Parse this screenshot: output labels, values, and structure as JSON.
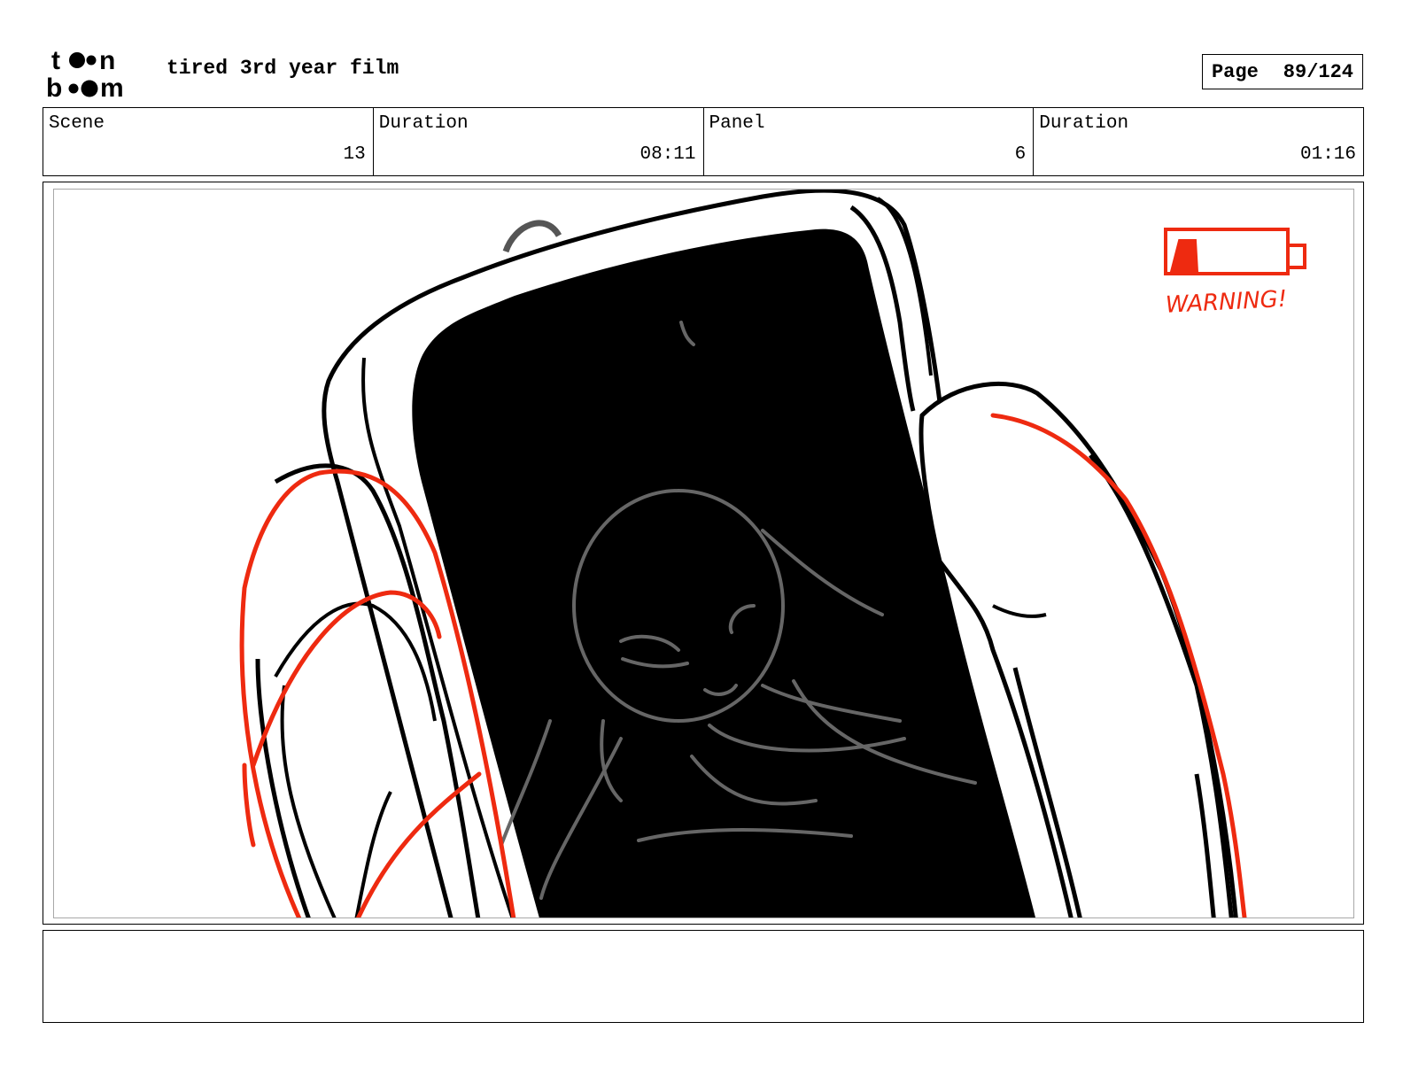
{
  "header": {
    "brand": "toon boom",
    "title": "tired 3rd year film",
    "page_label": "Page",
    "page_value": "89/124"
  },
  "info": [
    {
      "label": "Scene",
      "value": "13"
    },
    {
      "label": "Duration",
      "value": "08:11"
    },
    {
      "label": "Panel",
      "value": "6"
    },
    {
      "label": "Duration",
      "value": "01:16"
    }
  ],
  "panel": {
    "annotation": "WARNING!",
    "battery_level": 0.15
  },
  "notes": {
    "text": ""
  },
  "colors": {
    "sketch_red": "#ee2a10",
    "ink": "#000000",
    "face_gray": "#666666"
  }
}
